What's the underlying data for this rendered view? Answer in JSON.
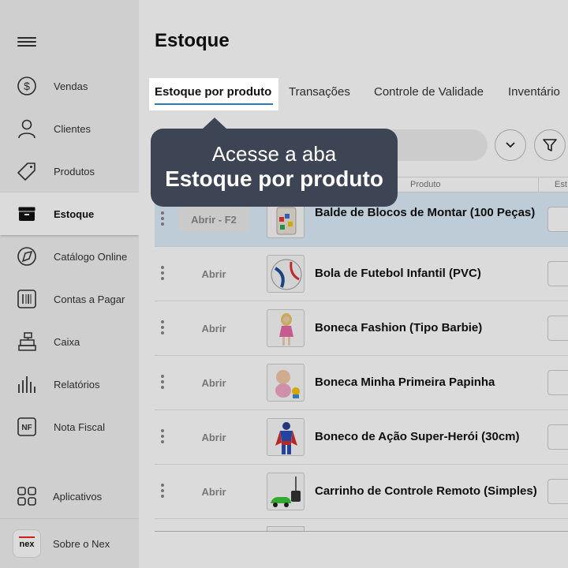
{
  "sidebar": {
    "items": [
      {
        "label": "Vendas",
        "icon": "dollar-circle-icon"
      },
      {
        "label": "Clientes",
        "icon": "user-icon"
      },
      {
        "label": "Produtos",
        "icon": "tag-icon"
      },
      {
        "label": "Estoque",
        "icon": "box-icon",
        "active": true
      },
      {
        "label": "Catálogo Online",
        "icon": "catalog-icon"
      },
      {
        "label": "Contas a Pagar",
        "icon": "barcode-icon"
      },
      {
        "label": "Caixa",
        "icon": "cash-register-icon"
      },
      {
        "label": "Relatórios",
        "icon": "bar-chart-icon"
      },
      {
        "label": "Nota Fiscal",
        "icon": "nf-icon",
        "icon_text": "NF"
      }
    ],
    "apps_label": "Aplicativos",
    "about_label": "Sobre o Nex",
    "logo_text": "nex"
  },
  "main": {
    "title": "Estoque",
    "tabs": [
      {
        "label": "Estoque por produto",
        "active": true
      },
      {
        "label": "Transações"
      },
      {
        "label": "Controle de Validade"
      },
      {
        "label": "Inventário"
      }
    ],
    "table": {
      "columns": [
        "Produto",
        "Est"
      ],
      "rows": [
        {
          "action": "Abrir - F2",
          "name": "Balde de Blocos de Montar (100 Peças)"
        },
        {
          "action": "Abrir",
          "name": "Bola de Futebol Infantil (PVC)"
        },
        {
          "action": "Abrir",
          "name": "Boneca Fashion (Tipo Barbie)"
        },
        {
          "action": "Abrir",
          "name": "Boneca Minha Primeira Papinha"
        },
        {
          "action": "Abrir",
          "name": "Boneco de Ação Super-Herói (30cm)"
        },
        {
          "action": "Abrir",
          "name": "Carrinho de Controle Remoto (Simples)"
        }
      ]
    }
  },
  "tooltip": {
    "line1": "Acesse a aba",
    "line2": "Estoque por produto"
  },
  "colors": {
    "accent": "#2a7ab8",
    "tooltip_bg": "#3d4454",
    "selected_row": "#ddeefb",
    "logo_red": "#e22222"
  }
}
